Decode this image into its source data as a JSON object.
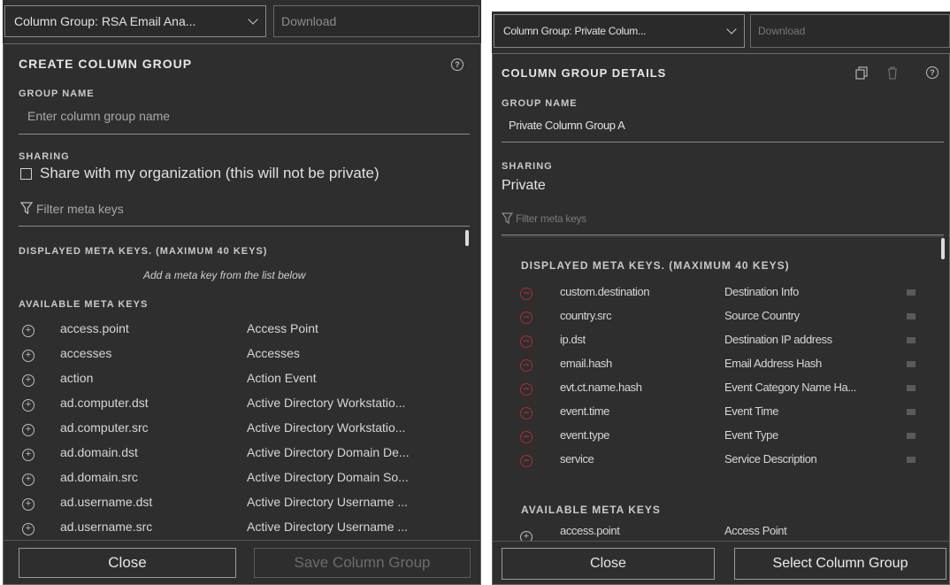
{
  "left": {
    "dropdown_label": "Column Group: RSA Email Ana...",
    "download_label": "Download",
    "title": "CREATE COLUMN GROUP",
    "group_name_label": "GROUP NAME",
    "group_name_placeholder": "Enter column group name",
    "sharing_label": "SHARING",
    "share_checkbox_label": "Share with my organization (this will not be private)",
    "filter_placeholder": "Filter meta keys",
    "displayed_header": "DISPLAYED META KEYS. (MAXIMUM 40 KEYS)",
    "displayed_hint": "Add a meta key from the list below",
    "available_header": "AVAILABLE META KEYS",
    "available": [
      {
        "key": "access.point",
        "desc": "Access Point"
      },
      {
        "key": "accesses",
        "desc": "Accesses"
      },
      {
        "key": "action",
        "desc": "Action Event"
      },
      {
        "key": "ad.computer.dst",
        "desc": "Active Directory Workstatio..."
      },
      {
        "key": "ad.computer.src",
        "desc": "Active Directory Workstatio..."
      },
      {
        "key": "ad.domain.dst",
        "desc": "Active Directory Domain De..."
      },
      {
        "key": "ad.domain.src",
        "desc": "Active Directory Domain So..."
      },
      {
        "key": "ad.username.dst",
        "desc": "Active Directory Username ..."
      },
      {
        "key": "ad.username.src",
        "desc": "Active Directory Username ..."
      }
    ],
    "close_label": "Close",
    "save_label": "Save Column Group"
  },
  "right": {
    "dropdown_label": "Column Group: Private Colum...",
    "download_label": "Download",
    "title": "COLUMN GROUP DETAILS",
    "group_name_label": "GROUP NAME",
    "group_name_value": "Private Column Group A",
    "sharing_label": "SHARING",
    "sharing_value": "Private",
    "filter_placeholder": "Filter meta keys",
    "displayed_header": "DISPLAYED META KEYS. (MAXIMUM 40 KEYS)",
    "displayed": [
      {
        "key": "custom.destination",
        "desc": "Destination Info"
      },
      {
        "key": "country.src",
        "desc": "Source Country"
      },
      {
        "key": "ip.dst",
        "desc": "Destination IP address"
      },
      {
        "key": "email.hash",
        "desc": "Email Address Hash"
      },
      {
        "key": "evt.ct.name.hash",
        "desc": "Event Category Name Ha..."
      },
      {
        "key": "event.time",
        "desc": "Event Time"
      },
      {
        "key": "event.type",
        "desc": "Event Type"
      },
      {
        "key": "service",
        "desc": "Service Description"
      }
    ],
    "available_header": "AVAILABLE META KEYS",
    "available": [
      {
        "key": "access.point",
        "desc": "Access Point"
      }
    ],
    "close_label": "Close",
    "select_label": "Select Column Group"
  }
}
